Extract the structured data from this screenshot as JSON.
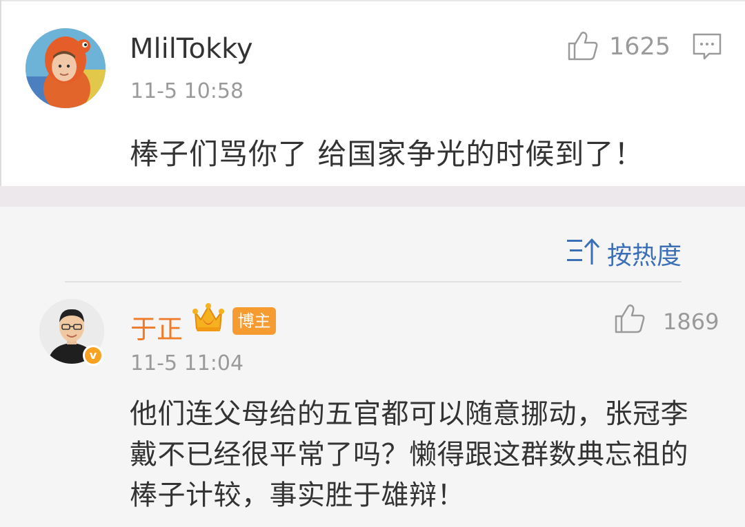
{
  "comments": [
    {
      "username": "MlilTokky",
      "time": "11-5 10:58",
      "likes": "1625",
      "text": "棒子们骂你了 给国家争光的时候到了！",
      "icons": [
        "avatar",
        "thumbs-up-icon",
        "comment-icon"
      ]
    },
    {
      "username": "于正",
      "badge": "博主",
      "verified_mark": "v",
      "time": "11-5 11:04",
      "likes": "1869",
      "text_lines": [
        "他们连父母给的五官都可以随意挪动，张冠李",
        "戴不已经很平常了吗？懒得跟这群数典忘祖的",
        "棒子计较，事实胜于雄辩！"
      ],
      "icons": [
        "avatar",
        "crown-icon",
        "thumbs-up-icon"
      ]
    }
  ],
  "sort": {
    "label": "按热度",
    "icon": "sort-icon"
  },
  "colors": {
    "accent_blue": "#3b6fb6",
    "author_orange": "#f07a28",
    "badge_orange": "#f59b2f",
    "meta_gray": "#9a9a9a",
    "text_dark": "#333333"
  }
}
